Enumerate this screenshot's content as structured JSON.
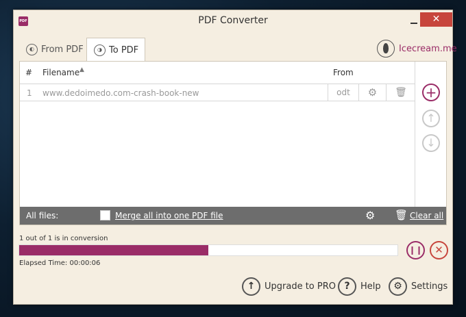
{
  "window": {
    "title": "PDF Converter",
    "app_icon_text": "PDF",
    "close_glyph": "✕"
  },
  "tabs": [
    {
      "label": "From PDF",
      "active": false
    },
    {
      "label": "To PDF",
      "active": true
    }
  ],
  "brand": {
    "label": "Icecream.me"
  },
  "table": {
    "columns": {
      "num": "#",
      "filename": "Filename",
      "from": "From"
    },
    "sort_glyph": "▲",
    "rows": [
      {
        "num": "1",
        "filename": "www.dedoimedo.com-crash-book-new",
        "type": "odt"
      }
    ]
  },
  "footer": {
    "all_files_label": "All files:",
    "merge_label": "Merge all into one PDF file",
    "merge_checked": false,
    "clear_all_label": "Clear all"
  },
  "conversion": {
    "status": "1 out of 1 is in conversion",
    "progress_fraction": 0.5,
    "elapsed": "Elapsed Time: 00:00:06"
  },
  "bottom": {
    "upgrade_label": "Upgrade to PRO",
    "help_label": "Help",
    "settings_label": "Settings"
  },
  "colors": {
    "accent": "#9a2c67",
    "close": "#c7453c",
    "footer_bar": "#6d6d6d"
  },
  "icons": {
    "gear": "⚙",
    "trash": "🗑",
    "add": "+",
    "up": "↑",
    "down": "↓",
    "pause": "❙❙",
    "cancel": "✕",
    "help": "?"
  }
}
